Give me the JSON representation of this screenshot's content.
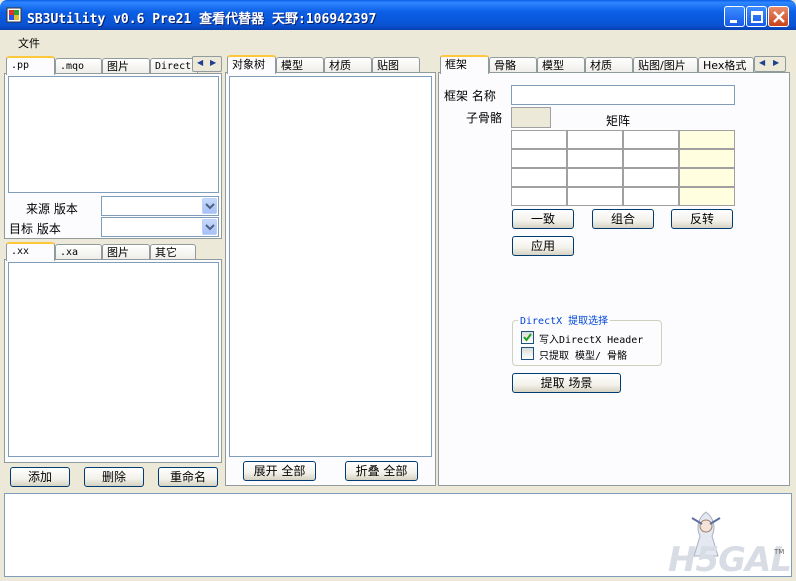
{
  "window": {
    "title": "SB3Utility v0.6 Pre21 查看代替器 天野:106942397"
  },
  "menu": {
    "file": "文件"
  },
  "left_top": {
    "tabs": [
      ".pp",
      ".mqo",
      "图片",
      "Direct"
    ],
    "source_version_label": "来源 版本",
    "target_version_label": "目标 版本",
    "source_version_value": "",
    "target_version_value": ""
  },
  "left_bottom": {
    "tabs": [
      ".xx",
      ".xa",
      "图片",
      "其它"
    ],
    "buttons": {
      "add": "添加",
      "delete": "删除",
      "rename": "重命名"
    }
  },
  "middle": {
    "tabs": [
      "对象树",
      "模型",
      "材质",
      "贴图"
    ],
    "buttons": {
      "expand_all": "展开 全部",
      "collapse_all": "折叠 全部"
    }
  },
  "right": {
    "tabs": [
      "框架",
      "骨骼",
      "模型",
      "材质",
      "贴图/图片",
      "Hex格式"
    ],
    "frame_name_label": "框架 名称",
    "frame_name_value": "",
    "child_bone_label": "子骨骼",
    "matrix_label": "矩阵",
    "buttons": {
      "identity": "一致",
      "combine": "组合",
      "invert": "反转",
      "apply": "应用",
      "extract_scene": "提取 场景"
    },
    "directx_group": {
      "title": "DirectX 提取选择",
      "write_header_label": "写入DirectX Header",
      "write_header_checked": true,
      "only_mesh_label": "只提取 模型/ 骨骼",
      "only_mesh_checked": false
    }
  },
  "logo": {
    "text": "H5GAL",
    "tm": "TM"
  },
  "colors": {
    "titlebar": "#0A5EE8",
    "window_bg": "#ECE9D8",
    "tab_highlight": "#FFC83C",
    "matrix_highlight": "#FFFFE0"
  }
}
